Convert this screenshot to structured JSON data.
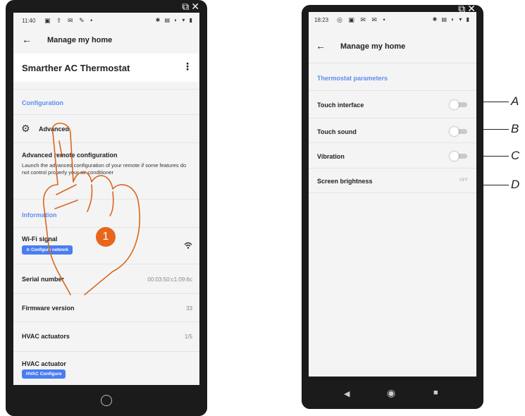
{
  "left_screen": {
    "status_time": "11:40",
    "title": "Manage my home",
    "device_name": "Smarther AC Thermostat",
    "configuration_section": "Configuration",
    "advanced_label": "Advanced",
    "advanced_config_title": "Advanced remote configuration",
    "advanced_config_desc": "Launch the advanced configuration of your remote if some features do not control properly your air conditioner",
    "information_section": "Information",
    "wifi_label": "Wi-Fi signal",
    "configure_network_button": "Configure network",
    "serial_label": "Serial number",
    "serial_value": "00:03:50:c1:09:6c",
    "firmware_label": "Firmware version",
    "firmware_value": "33",
    "hvac_actuators_label": "HVAC actuators",
    "hvac_actuators_value": "1/5",
    "hvac_actuator_label": "HVAC actuator",
    "hvac_configure_button": "HVAC Configure",
    "step_badge": "1"
  },
  "right_screen": {
    "status_time": "18:23",
    "title": "Manage my home",
    "section_title": "Thermostat parameters",
    "touch_interface_label": "Touch interface",
    "touch_interface_on": false,
    "touch_sound_label": "Touch sound",
    "touch_sound_on": false,
    "vibration_label": "Vibration",
    "vibration_on": false,
    "screen_brightness_label": "Screen brightness",
    "screen_brightness_value": "OFF"
  },
  "callouts": {
    "a": "A",
    "b": "B",
    "c": "C",
    "d": "D"
  },
  "colors": {
    "accent_blue": "#5e8df0",
    "button_blue": "#4a7df0",
    "badge_orange": "#e8661c",
    "hand_stroke": "#d9661e"
  }
}
